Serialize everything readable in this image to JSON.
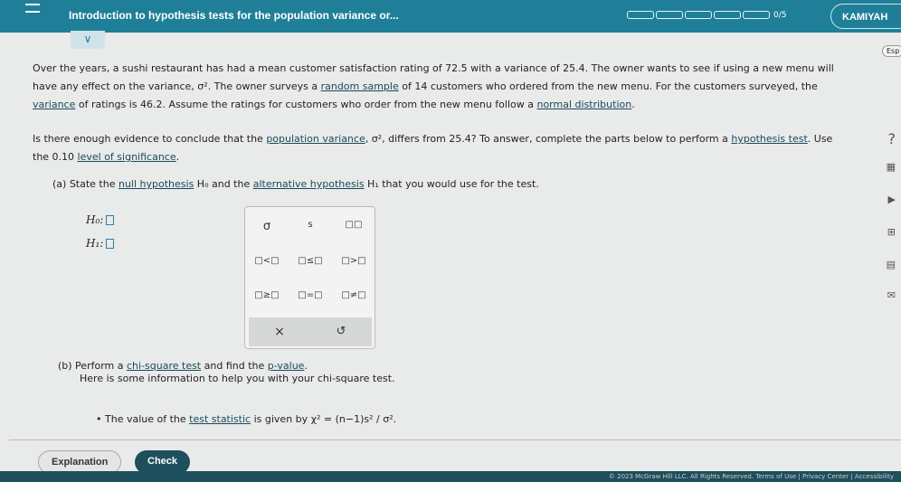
{
  "header": {
    "title": "Introduction to hypothesis tests for the population variance or...",
    "progress": "0/5",
    "progress_value": 0,
    "user": "KAMIYAH"
  },
  "lang": "Esp",
  "problem": {
    "p1": "Over the years, a sushi restaurant has had a mean customer satisfaction rating of 72.5 with a variance of 25.4. The owner wants to see if using a new menu will",
    "p2a": "have any effect on the variance, σ². The owner surveys a ",
    "p2link": "random sample",
    "p2b": " of 14 customers who ordered from the new menu. For the customers surveyed, the",
    "p3link": "variance",
    "p3a": " of ratings is 46.2. Assume the ratings for customers who order from the new menu follow a ",
    "p3link2": "normal distribution",
    "p3b": ".",
    "q1a": "Is there enough evidence to conclude that the ",
    "q1link": "population variance",
    "q1b": ", σ², differs from 25.4? To answer, complete the parts below to perform a ",
    "q1link2": "hypothesis test",
    "q1c": ". Use",
    "q2a": "the 0.10 ",
    "q2link": "level of significance",
    "q2b": "."
  },
  "part_a": {
    "a1": "(a) State the ",
    "link1": "null hypothesis",
    "a2": " H₀ and the ",
    "link2": "alternative hypothesis",
    "a3": " H₁ that you would use for the test.",
    "h0": "H₀:",
    "h1": "H₁:"
  },
  "palette": {
    "buttons": [
      "σ",
      "s",
      "□□",
      "□<□",
      "□≤□",
      "□>□",
      "□≥□",
      "□=□",
      "□≠□"
    ],
    "clear": "×",
    "undo": "↺"
  },
  "part_b": {
    "b1": "(b) Perform a ",
    "link": "chi-square test",
    "b2": " and find the ",
    "link2": "p-value",
    "b3": ".",
    "b4": "Here is some information to help you with your chi-square test.",
    "bullet_a": "The value of the ",
    "bullet_link": "test statistic",
    "bullet_b": " is given by χ² = (n−1)s² / σ²."
  },
  "buttons": {
    "explanation": "Explanation",
    "check": "Check"
  },
  "footer": "© 2023 McGraw Hill LLC. All Rights Reserved.   Terms of Use  |  Privacy Center  |  Accessibility"
}
